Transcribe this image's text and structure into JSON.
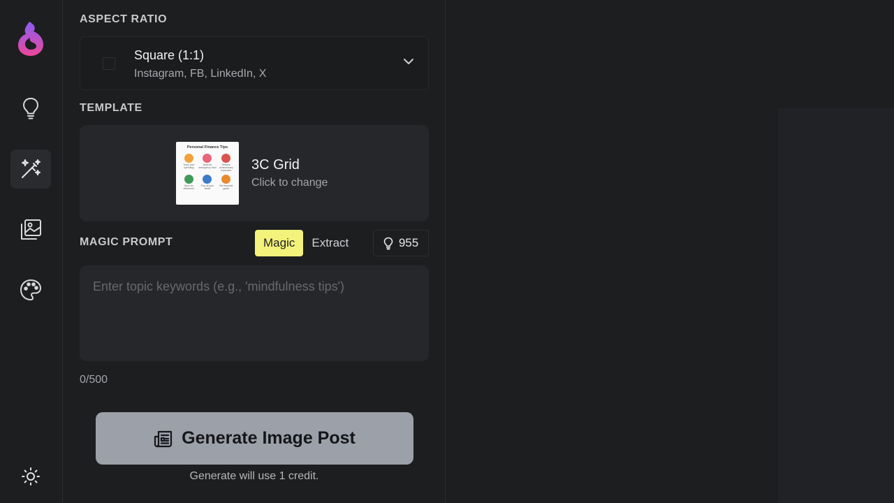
{
  "rail": {
    "items": [
      {
        "name": "logo-flame-icon"
      },
      {
        "name": "lightbulb-icon"
      },
      {
        "name": "magic-wand-icon",
        "active": true
      },
      {
        "name": "image-gallery-icon"
      },
      {
        "name": "palette-icon"
      },
      {
        "name": "sun-icon"
      }
    ]
  },
  "aspect": {
    "label": "ASPECT RATIO",
    "title": "Square (1:1)",
    "subtitle": "Instagram, FB, LinkedIn, X"
  },
  "template": {
    "label": "TEMPLATE",
    "name": "3C Grid",
    "hint": "Click to change",
    "thumbnail": {
      "title": "Personal Finance Tips",
      "items": [
        {
          "caption": "Track your spending",
          "color": "#f2a23a"
        },
        {
          "caption": "Build an emergency fund",
          "color": "#e8657a"
        },
        {
          "caption": "Reduce unnecessary expenses",
          "color": "#d9544d"
        },
        {
          "caption": "Save for retirement",
          "color": "#3f9a5a"
        },
        {
          "caption": "Pay off your debts",
          "color": "#3b7bc8"
        },
        {
          "caption": "Set financial goals",
          "color": "#e88a2f"
        }
      ]
    }
  },
  "prompt": {
    "label": "MAGIC PROMPT",
    "tabs": [
      {
        "label": "Magic",
        "active": true
      },
      {
        "label": "Extract",
        "active": false
      }
    ],
    "credits": "955",
    "placeholder": "Enter topic keywords (e.g., 'mindfulness tips')",
    "value": "",
    "counter": "0/500"
  },
  "generate": {
    "label": "Generate Image Post",
    "note": "Generate will use 1 credit."
  },
  "colors": {
    "accent_yellow": "#f3f27a",
    "button_gray": "#9ca0a8",
    "background": "#1d1e20",
    "surface": "#26272a"
  }
}
